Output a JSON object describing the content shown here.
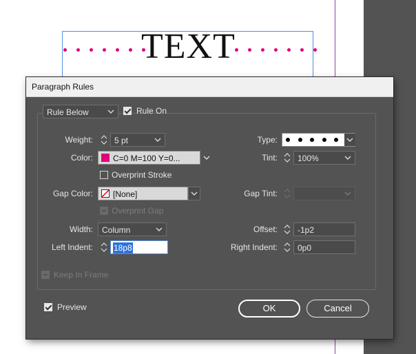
{
  "document": {
    "frame_text": "TEXT",
    "rule_color": "#e0007a"
  },
  "dialog": {
    "title": "Paragraph Rules",
    "rule_selector": {
      "value": "Rule Below"
    },
    "rule_on": {
      "label": "Rule On",
      "checked": true
    },
    "weight": {
      "label": "Weight:",
      "value": "5 pt"
    },
    "type": {
      "label": "Type:",
      "value": "dots"
    },
    "color": {
      "label": "Color:",
      "value": "C=0 M=100 Y=0...",
      "swatch": "#e0007a"
    },
    "tint": {
      "label": "Tint:",
      "value": "100%"
    },
    "overprint_stroke": {
      "label": "Overprint Stroke",
      "checked": false
    },
    "gap_color": {
      "label": "Gap Color:",
      "value": "[None]"
    },
    "gap_tint": {
      "label": "Gap Tint:",
      "value": ""
    },
    "overprint_gap": {
      "label": "Overprint Gap",
      "enabled": false
    },
    "width": {
      "label": "Width:",
      "value": "Column"
    },
    "offset": {
      "label": "Offset:",
      "value": "-1p2"
    },
    "left_indent": {
      "label": "Left Indent:",
      "value": "18p8"
    },
    "right_indent": {
      "label": "Right Indent:",
      "value": "0p0"
    },
    "keep_in_frame": {
      "label": "Keep In Frame",
      "enabled": false
    },
    "preview": {
      "label": "Preview",
      "checked": true
    },
    "ok_label": "OK",
    "cancel_label": "Cancel"
  }
}
